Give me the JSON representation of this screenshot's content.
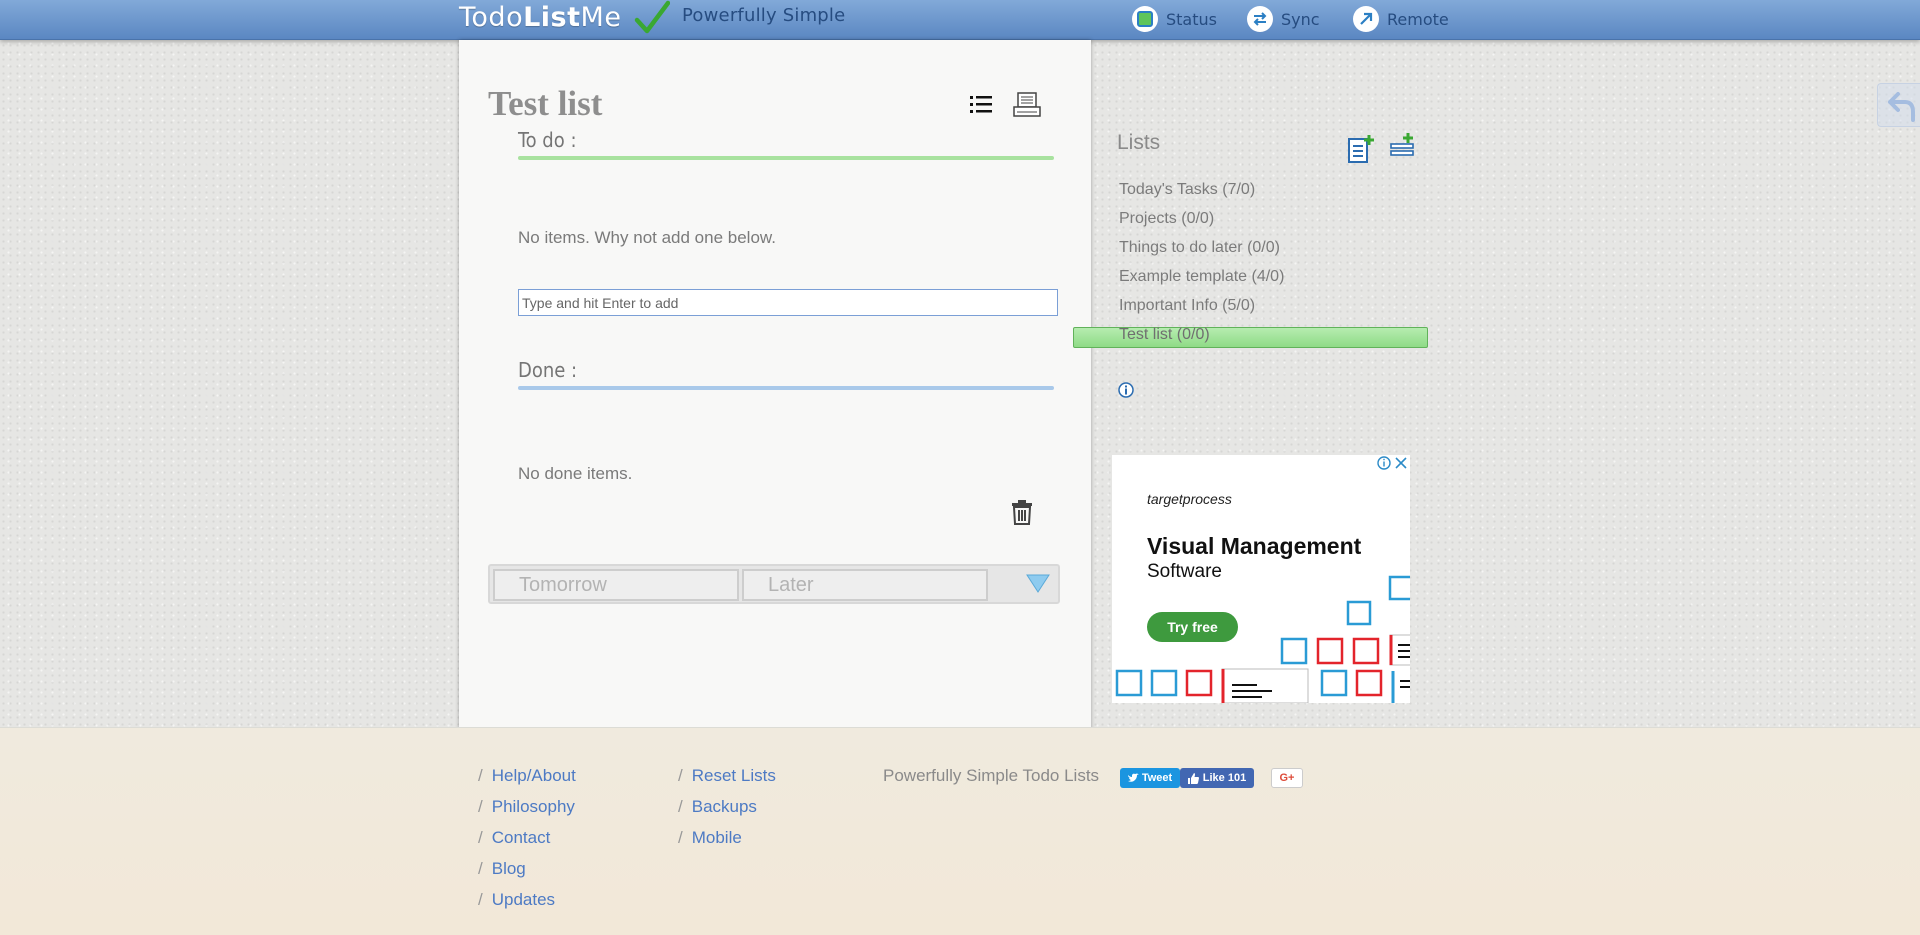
{
  "header": {
    "logo_todo": "Todo",
    "logo_list": "List",
    "logo_me": "Me",
    "tagline": "Powerfully Simple",
    "nav": [
      {
        "label": "Status",
        "icon": "status-icon"
      },
      {
        "label": "Sync",
        "icon": "sync-icon"
      },
      {
        "label": "Remote",
        "icon": "remote-icon"
      }
    ]
  },
  "list": {
    "title": "Test list",
    "todo_heading": "To do :",
    "todo_empty": "No items. Why not add one below.",
    "add_placeholder": "Type and hit Enter to add",
    "done_heading": "Done :",
    "done_empty": "No done items.",
    "tabs": [
      "Tomorrow",
      "Later"
    ]
  },
  "sidebar": {
    "heading": "Lists",
    "items": [
      {
        "label": "Today's Tasks (7/0)"
      },
      {
        "label": "Projects (0/0)"
      },
      {
        "label": "Things to do later (0/0)"
      },
      {
        "label": "Example template (4/0)"
      },
      {
        "label": "Important Info (5/0)"
      },
      {
        "label": "Test list (0/0)"
      }
    ],
    "active_index": 5
  },
  "ad": {
    "brand": "targetprocess",
    "headline": "Visual Management",
    "subline": "Software",
    "cta": "Try free"
  },
  "footer": {
    "col1": [
      "Help/About",
      "Philosophy",
      "Contact",
      "Blog",
      "Updates"
    ],
    "col2": [
      "Reset Lists",
      "Backups",
      "Mobile"
    ],
    "tagline": "Powerfully Simple Todo Lists",
    "tweet": "Tweet",
    "like": "Like 101",
    "gplus": "G+"
  },
  "colors": {
    "topbar": "#6b96cc",
    "todo_rule": "#a8e29f",
    "done_rule": "#a9c9ea",
    "active_list": "#a2e398",
    "link": "#4d7ac4"
  }
}
